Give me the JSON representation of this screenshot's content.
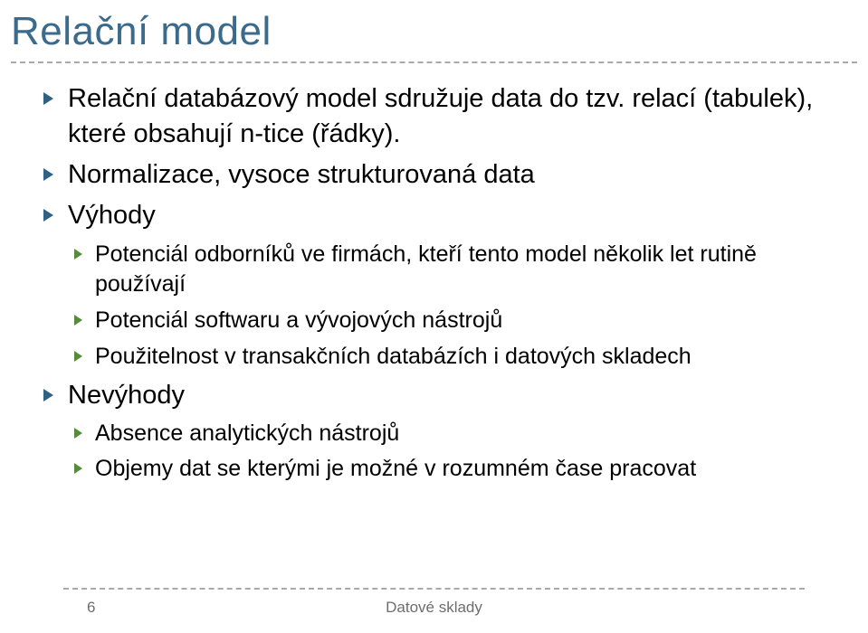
{
  "title": "Relační model",
  "bullets": {
    "b0": "Relační databázový model sdružuje data do tzv. relací (tabulek), které obsahují n-tice (řádky).",
    "b1": "Normalizace, vysoce strukturovaná data",
    "b2": "Výhody",
    "b2a": "Potenciál odborníků ve firmách, kteří tento model několik let rutině používají",
    "b2b": "Potenciál softwaru a vývojových nástrojů",
    "b2c": "Použitelnost v transakčních databázích i datových skladech",
    "b3": "Nevýhody",
    "b3a": "Absence analytických nástrojů",
    "b3b": "Objemy dat se kterými je možné v rozumném čase pracovat"
  },
  "footer": {
    "page": "6",
    "label": "Datové sklady"
  }
}
